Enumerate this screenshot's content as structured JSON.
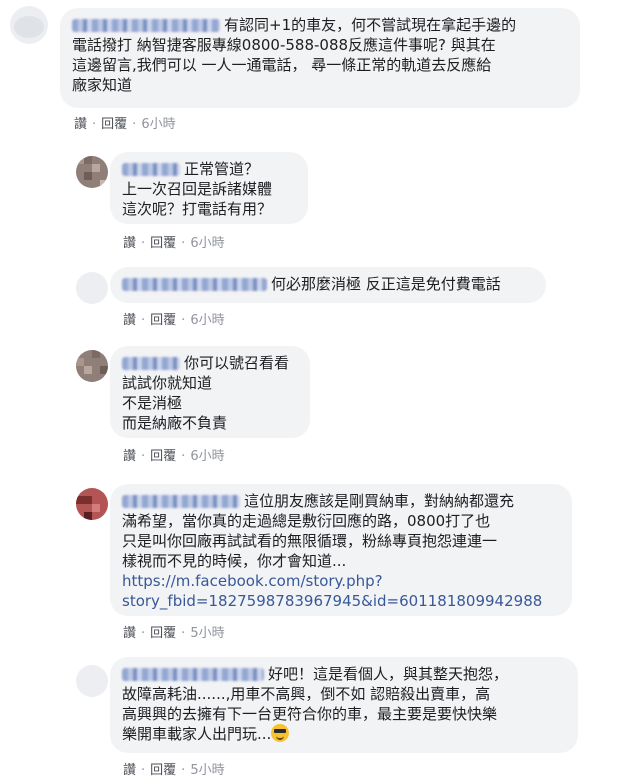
{
  "comments": [
    {
      "lines": [
        "有認同+1的車友，何不嘗試現在拿起手邊的",
        "電話撥打 納智捷客服專線0800-588-088反應這件事呢? 與其在",
        "這邊留言,我們可以 一人一通電話， 尋一條正常的軌道去反應給",
        "廠家知道"
      ],
      "like": "讚",
      "reply": "回覆",
      "time": "6小時"
    },
    {
      "lines": [
        "正常管道？",
        "上一次召回是訴諸媒體",
        "這次呢？打電話有用？"
      ],
      "like": "讚",
      "reply": "回覆",
      "time": "6小時"
    },
    {
      "lines": [
        "何必那麼消極 反正這是免付費電話"
      ],
      "like": "讚",
      "reply": "回覆",
      "time": "6小時"
    },
    {
      "lines": [
        "你可以號召看看",
        "試試你就知道",
        "不是消極",
        "而是納廠不負責"
      ],
      "like": "讚",
      "reply": "回覆",
      "time": "6小時"
    },
    {
      "lines": [
        "這位朋友應該是剛買納車，對納納都還充",
        "滿希望，當你真的走過總是敷衍回應的路，0800打了也",
        "只是叫你回廠再試試看的無限循環，粉絲專頁抱怨連連一",
        "樣視而不見的時候，你才會知道..."
      ],
      "link_lines": [
        "https://m.facebook.com/story.php?",
        "story_fbid=1827598783967945&id=601181809942988"
      ],
      "like": "讚",
      "reply": "回覆",
      "time": "5小時"
    },
    {
      "lines": [
        "好吧！這是看個人，與其整天抱怨，",
        "故障高耗油......,用車不高興，倒不如 認賠殺出賣車，高",
        "高興興的去擁有下一台更符合你的車，最主要是要快快樂",
        "樂開車載家人出門玩..."
      ],
      "emoji": "sunglasses-emoji",
      "like": "讚",
      "reply": "回覆",
      "time": "5小時"
    }
  ]
}
